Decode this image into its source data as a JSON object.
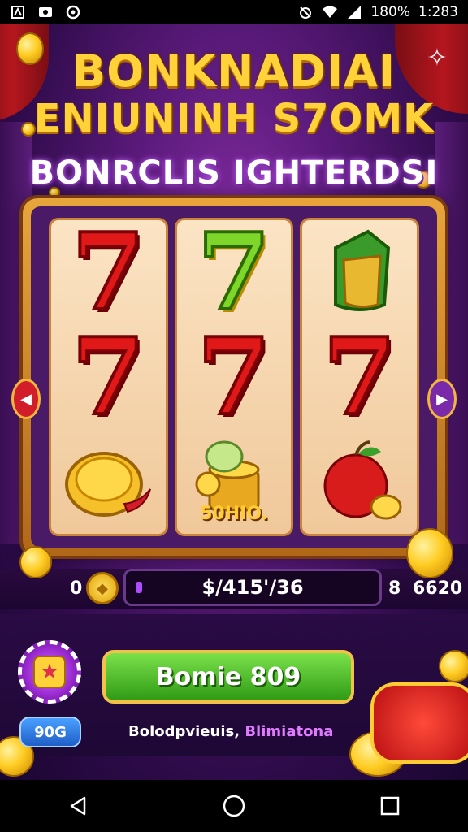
{
  "status_bar": {
    "battery": "180%",
    "time": "1:283"
  },
  "game": {
    "title_line1": "BONKNADIAI",
    "title_line2": "ENIUNINH S7OMK",
    "title_line3": "BONRCLIS IGHTERDSI",
    "reels": [
      {
        "symbols": [
          "red-seven",
          "red-seven",
          "gold-coin-with-chili"
        ]
      },
      {
        "symbols": [
          "green-seven",
          "red-seven",
          "gold-coin-stack"
        ],
        "label": "50HIO."
      },
      {
        "symbols": [
          "green-money-bag",
          "red-seven",
          "red-apple"
        ]
      }
    ],
    "info_bar": {
      "left_value": "0",
      "balance": "$/415'/36",
      "right_value_1": "8",
      "right_value_2": "6620"
    },
    "small_button_label": "90G",
    "main_button_label": "Bomie 809",
    "bottom_text_white": "Bolodpvieuis,",
    "bottom_text_purple": "Blimiatona"
  },
  "colors": {
    "title_gold": "#ffd23a",
    "green_button": "#2f9a16",
    "purple_background": "#5a1a7a",
    "red_seven": "#e01818"
  }
}
